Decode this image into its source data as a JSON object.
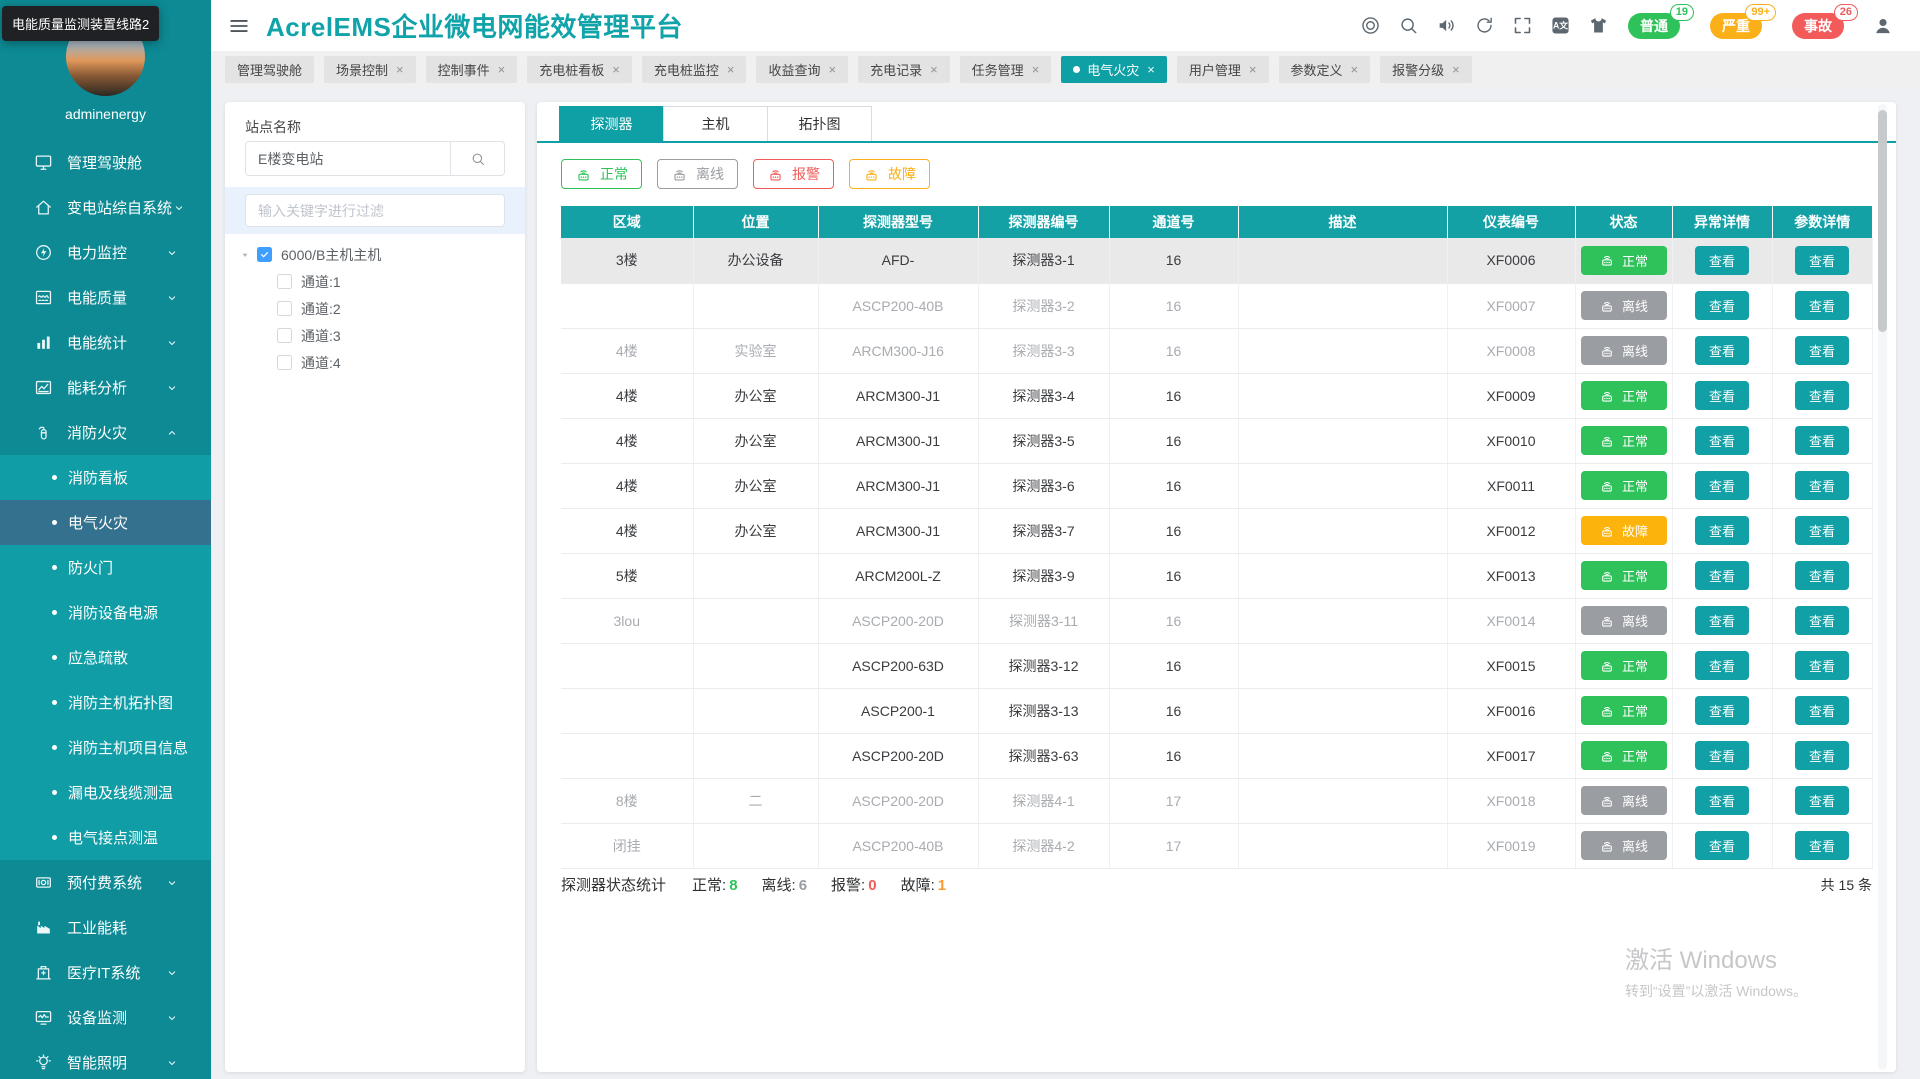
{
  "tooltip": {
    "text": "电能质量监测装置线路2"
  },
  "sidebar": {
    "username": "adminenergy",
    "menu": [
      {
        "key": "dashboard",
        "label": "管理驾驶舱",
        "icon": "dashboard-icon"
      },
      {
        "key": "substation-system",
        "label": "变电站综自系统",
        "icon": "home-icon",
        "chevron": "down"
      },
      {
        "key": "power-monitor",
        "label": "电力监控",
        "icon": "power-icon",
        "chevron": "down"
      },
      {
        "key": "power-quality",
        "label": "电能质量",
        "icon": "quality-chart-icon",
        "chevron": "down"
      },
      {
        "key": "power-stats",
        "label": "电能统计",
        "icon": "bar-chart-icon",
        "chevron": "down"
      },
      {
        "key": "energy-analysis",
        "label": "能耗分析",
        "icon": "trend-chart-icon",
        "chevron": "down"
      },
      {
        "key": "fire-safety",
        "label": "消防火灾",
        "icon": "fire-extinguisher-icon",
        "chevron": "up",
        "expanded": true,
        "children": [
          {
            "key": "fire-board",
            "label": "消防看板"
          },
          {
            "key": "electrical-fire",
            "label": "电气火灾",
            "active": true
          },
          {
            "key": "fire-door",
            "label": "防火门"
          },
          {
            "key": "fire-equipment-power",
            "label": "消防设备电源"
          },
          {
            "key": "emergency-evacuation",
            "label": "应急疏散"
          },
          {
            "key": "fire-host-topology",
            "label": "消防主机拓扑图"
          },
          {
            "key": "fire-host-project-info",
            "label": "消防主机项目信息"
          },
          {
            "key": "leakage-cable-temp",
            "label": "漏电及线缆测温"
          },
          {
            "key": "electrical-contact-temp",
            "label": "电气接点测温"
          }
        ]
      },
      {
        "key": "prepaid-system",
        "label": "预付费系统",
        "icon": "prepaid-icon",
        "chevron": "down"
      },
      {
        "key": "industrial-energy",
        "label": "工业能耗",
        "icon": "factory-icon"
      },
      {
        "key": "medical-it",
        "label": "医疗IT系统",
        "icon": "hospital-icon",
        "chevron": "down"
      },
      {
        "key": "device-monitor",
        "label": "设备监测",
        "icon": "device-monitor-icon",
        "chevron": "down"
      },
      {
        "key": "smart-lighting",
        "label": "智能照明",
        "icon": "bulb-icon",
        "chevron": "down"
      }
    ]
  },
  "header": {
    "title": "AcrelEMS企业微电网能效管理平台",
    "tool_icons": [
      "help-circle-icon",
      "search-icon",
      "volume-icon",
      "refresh-icon",
      "fullscreen-icon",
      "translate-icon",
      "theme-shirt-icon"
    ],
    "alarm_badges": [
      {
        "key": "normal",
        "label": "普通",
        "count": "19",
        "color": "#2fc25b"
      },
      {
        "key": "severe",
        "label": "严重",
        "count": "99+",
        "color": "#fbb019"
      },
      {
        "key": "accident",
        "label": "事故",
        "count": "26",
        "color": "#f35b5b"
      }
    ],
    "user_icon": "user-icon"
  },
  "tabbar": {
    "tabs": [
      {
        "label": "管理驾驶舱",
        "closable": false
      },
      {
        "label": "场景控制",
        "closable": true
      },
      {
        "label": "控制事件",
        "closable": true
      },
      {
        "label": "充电桩看板",
        "closable": true
      },
      {
        "label": "充电桩监控",
        "closable": true
      },
      {
        "label": "收益查询",
        "closable": true
      },
      {
        "label": "充电记录",
        "closable": true
      },
      {
        "label": "任务管理",
        "closable": true
      },
      {
        "label": "电气火灾",
        "closable": true,
        "active": true
      },
      {
        "label": "用户管理",
        "closable": true
      },
      {
        "label": "参数定义",
        "closable": true
      },
      {
        "label": "报警分级",
        "closable": true
      }
    ]
  },
  "site_panel": {
    "label": "站点名称",
    "search_value": "E楼变电站",
    "filter_placeholder": "输入关键字进行过滤",
    "tree": {
      "root": {
        "label": "6000/B主机主机",
        "checked": true
      },
      "children": [
        {
          "label": "通道:1"
        },
        {
          "label": "通道:2"
        },
        {
          "label": "通道:3"
        },
        {
          "label": "通道:4"
        }
      ]
    }
  },
  "main": {
    "tabs": [
      {
        "key": "detector",
        "label": "探测器",
        "active": true
      },
      {
        "key": "host",
        "label": "主机",
        "active": false
      },
      {
        "key": "topology",
        "label": "拓扑图",
        "active": false
      }
    ],
    "filters": [
      {
        "key": "normal",
        "label": "正常",
        "color": "#2fc25b"
      },
      {
        "key": "offline",
        "label": "离线",
        "color": "#9a9da1"
      },
      {
        "key": "alarm",
        "label": "报警",
        "color": "#f35b5b"
      },
      {
        "key": "fault",
        "label": "故障",
        "color": "#fbb019"
      }
    ],
    "table": {
      "headers": [
        "区域",
        "位置",
        "探测器型号",
        "探测器编号",
        "通道号",
        "描述",
        "仪表编号",
        "状态",
        "异常详情",
        "参数详情"
      ],
      "col_keys": [
        "region",
        "location",
        "model",
        "detector-no",
        "channel",
        "description",
        "meter-no",
        "status",
        "exception-detail",
        "param-detail"
      ],
      "view_label": "查看",
      "status_styles": {
        "normal": {
          "label": "正常",
          "color": "#2fc25b"
        },
        "offline": {
          "label": "离线",
          "color": "#9a9da1"
        },
        "fault": {
          "label": "故障",
          "color": "#fcb30c"
        }
      },
      "rows": [
        {
          "region": "3楼",
          "location": "办公设备",
          "model": "AFD-",
          "detector_no": "探测器3-1",
          "channel": "16",
          "description": "",
          "meter_no": "XF0006",
          "status": "normal",
          "selected": true
        },
        {
          "region": "",
          "location": "",
          "model": "ASCP200-40B",
          "detector_no": "探测器3-2",
          "channel": "16",
          "description": "",
          "meter_no": "XF0007",
          "status": "offline"
        },
        {
          "region": "4楼",
          "location": "实验室",
          "model": "ARCM300-J16",
          "detector_no": "探测器3-3",
          "channel": "16",
          "description": "",
          "meter_no": "XF0008",
          "status": "offline"
        },
        {
          "region": "4楼",
          "location": "办公室",
          "model": "ARCM300-J1",
          "detector_no": "探测器3-4",
          "channel": "16",
          "description": "",
          "meter_no": "XF0009",
          "status": "normal"
        },
        {
          "region": "4楼",
          "location": "办公室",
          "model": "ARCM300-J1",
          "detector_no": "探测器3-5",
          "channel": "16",
          "description": "",
          "meter_no": "XF0010",
          "status": "normal"
        },
        {
          "region": "4楼",
          "location": "办公室",
          "model": "ARCM300-J1",
          "detector_no": "探测器3-6",
          "channel": "16",
          "description": "",
          "meter_no": "XF0011",
          "status": "normal"
        },
        {
          "region": "4楼",
          "location": "办公室",
          "model": "ARCM300-J1",
          "detector_no": "探测器3-7",
          "channel": "16",
          "description": "",
          "meter_no": "XF0012",
          "status": "fault"
        },
        {
          "region": "5楼",
          "location": "",
          "model": "ARCM200L-Z",
          "detector_no": "探测器3-9",
          "channel": "16",
          "description": "",
          "meter_no": "XF0013",
          "status": "normal"
        },
        {
          "region": "3lou",
          "location": "",
          "model": "ASCP200-20D",
          "detector_no": "探测器3-11",
          "channel": "16",
          "description": "",
          "meter_no": "XF0014",
          "status": "offline"
        },
        {
          "region": "",
          "location": "",
          "model": "ASCP200-63D",
          "detector_no": "探测器3-12",
          "channel": "16",
          "description": "",
          "meter_no": "XF0015",
          "status": "normal"
        },
        {
          "region": "",
          "location": "",
          "model": "ASCP200-1",
          "detector_no": "探测器3-13",
          "channel": "16",
          "description": "",
          "meter_no": "XF0016",
          "status": "normal"
        },
        {
          "region": "",
          "location": "",
          "model": "ASCP200-20D",
          "detector_no": "探测器3-63",
          "channel": "16",
          "description": "",
          "meter_no": "XF0017",
          "status": "normal"
        },
        {
          "region": "8楼",
          "location": "二",
          "model": "ASCP200-20D",
          "detector_no": "探测器4-1",
          "channel": "17",
          "description": "",
          "meter_no": "XF0018",
          "status": "offline"
        },
        {
          "region": "闭挂",
          "location": "",
          "model": "ASCP200-40B",
          "detector_no": "探测器4-2",
          "channel": "17",
          "description": "",
          "meter_no": "XF0019",
          "status": "offline"
        }
      ]
    },
    "stats": {
      "title": "探测器状态统计",
      "items": [
        {
          "key": "normal",
          "label": "正常",
          "value": "8",
          "color": "#2fc25b"
        },
        {
          "key": "offline",
          "label": "离线",
          "value": "6",
          "color": "#9a9da1"
        },
        {
          "key": "alarm",
          "label": "报警",
          "value": "0",
          "color": "#f35b5b"
        },
        {
          "key": "fault",
          "label": "故障",
          "value": "1",
          "color": "#fb9a2d"
        }
      ]
    },
    "total": "共 15 条"
  },
  "watermark": {
    "line1": "激活 Windows",
    "line2": "转到“设置”以激活 Windows。"
  }
}
